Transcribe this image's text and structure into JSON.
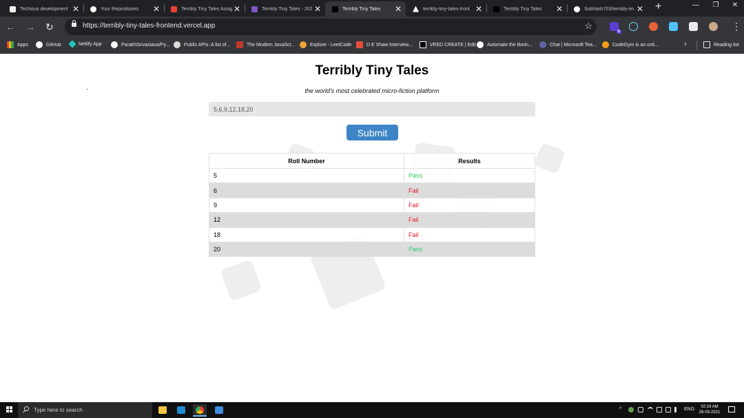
{
  "browser": {
    "tabs": [
      {
        "title": "Techious development",
        "active": false
      },
      {
        "title": "Your Repositories",
        "active": false
      },
      {
        "title": "Terribly Tiny Tales Assig",
        "active": false
      },
      {
        "title": "Terribly Tiny Tales - 202",
        "active": false
      },
      {
        "title": "Terribly Tiny Tales",
        "active": true
      },
      {
        "title": "terribly-tiny-tales-front",
        "active": false
      },
      {
        "title": "Terribly Tiny Tales",
        "active": false
      },
      {
        "title": "Subhash703/terribly-tin",
        "active": false
      }
    ],
    "close_glyph": "✕",
    "new_tab_glyph": "+",
    "window_controls": [
      "—",
      "❐",
      "✕"
    ],
    "url": "https://terribly-tiny-tales-frontend.vercel.app",
    "bookmarks": [
      {
        "label": "Apps",
        "icon": "apps-grid-icon"
      },
      {
        "label": "GitHub",
        "icon": "github-icon"
      },
      {
        "label": "Netlify App",
        "icon": "netlify-icon"
      },
      {
        "label": "ParakhSrivastava/Py...",
        "icon": "github-icon"
      },
      {
        "label": "Public APIs: A list of...",
        "icon": "globe-icon"
      },
      {
        "label": "The Modern JavaScr...",
        "icon": "js-icon"
      },
      {
        "label": "Explore - LeetCode",
        "icon": "leetcode-icon"
      },
      {
        "label": "D E Shaw Interview...",
        "icon": "desk-icon"
      },
      {
        "label": "VEED CREATE | Edit",
        "icon": "veed-icon"
      },
      {
        "label": "Automate the Borin...",
        "icon": "github-icon"
      },
      {
        "label": "Chat | Microsoft Tea...",
        "icon": "teams-icon"
      },
      {
        "label": "CodeGym is an onli...",
        "icon": "codegym-icon"
      }
    ],
    "reading_list": "Reading list",
    "extension_badge": "6"
  },
  "app": {
    "title": "Terribly Tiny Tales",
    "subtitle": "the world's most celebrated micro-fiction platform",
    "input_value": "5,6,9,12,18,20",
    "submit_label": "Submit",
    "table": {
      "headers": [
        "Roll Number",
        "Results"
      ],
      "rows": [
        {
          "roll": "5",
          "result": "Pass"
        },
        {
          "roll": "6",
          "result": "Fail"
        },
        {
          "roll": "9",
          "result": "Fail"
        },
        {
          "roll": "12",
          "result": "Fail"
        },
        {
          "roll": "18",
          "result": "Fail"
        },
        {
          "roll": "20",
          "result": "Pass"
        }
      ]
    },
    "colors": {
      "pass": "#2ecc71",
      "fail": "#e8172b",
      "accent": "#3d85c6"
    }
  },
  "taskbar": {
    "search_placeholder": "Type here to search",
    "language": "ENG",
    "time": "02:19 AM",
    "date": "26-03-2021",
    "tray_glyphs": "^"
  }
}
